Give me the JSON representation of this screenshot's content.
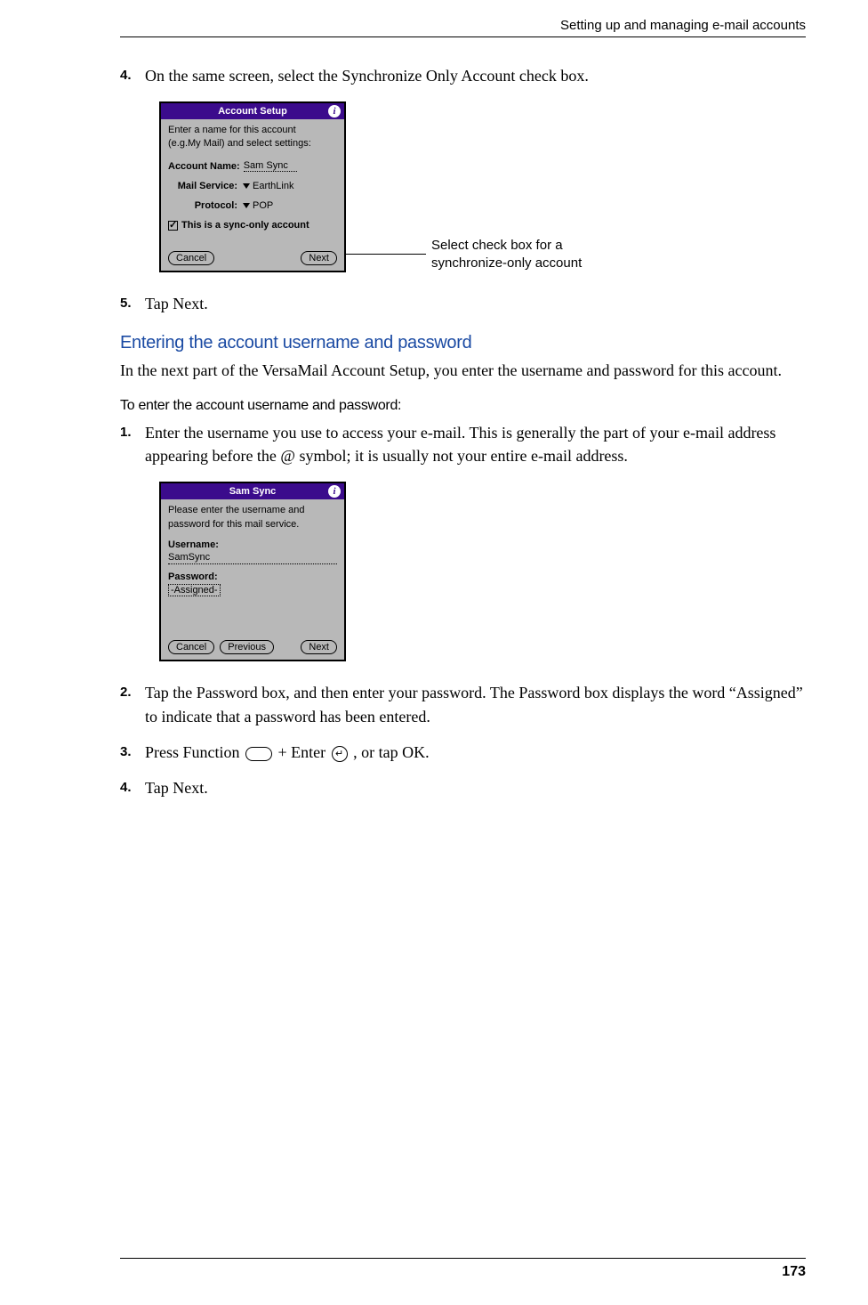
{
  "header": {
    "section_title": "Setting up and managing e-mail accounts"
  },
  "step4": {
    "num": "4.",
    "text": "On the same screen, select the Synchronize Only Account check box."
  },
  "screen1": {
    "title": "Account Setup",
    "instr1": "Enter a name for this account",
    "instr2": "(e.g.My Mail) and select settings:",
    "account_name_label": "Account Name:",
    "account_name_value": "Sam Sync",
    "mail_service_label": "Mail Service:",
    "mail_service_value": "EarthLink",
    "protocol_label": "Protocol:",
    "protocol_value": "POP",
    "checkbox_label": "This is a sync-only account",
    "cancel": "Cancel",
    "next": "Next"
  },
  "callout1": "Select check box for a synchronize-only account",
  "step5": {
    "num": "5.",
    "text": "Tap Next."
  },
  "heading1": "Entering the account username and password",
  "para1": "In the next part of the VersaMail Account Setup, you enter the username and password for this account.",
  "subheading1": "To enter the account username and password:",
  "up_step1": {
    "num": "1.",
    "text": "Enter the username you use to access your e-mail. This is generally the part of your e-mail address appearing before the @ symbol; it is usually not your entire e-mail address."
  },
  "screen2": {
    "title": "Sam Sync",
    "instr1": "Please enter the username and",
    "instr2": "password for this mail service.",
    "username_label": "Username:",
    "username_value": "SamSync",
    "password_label": "Password:",
    "password_value": "-Assigned-",
    "cancel": "Cancel",
    "previous": "Previous",
    "next": "Next"
  },
  "up_step2": {
    "num": "2.",
    "text": "Tap the Password box, and then enter your password. The Password box displays the word “Assigned” to indicate that a password has been entered."
  },
  "up_step3": {
    "num": "3.",
    "text_a": "Press Function ",
    "text_b": " + Enter ",
    "text_c": ", or tap OK.",
    "enter_glyph": "↵"
  },
  "up_step4": {
    "num": "4.",
    "text": "Tap Next."
  },
  "page_number": "173"
}
